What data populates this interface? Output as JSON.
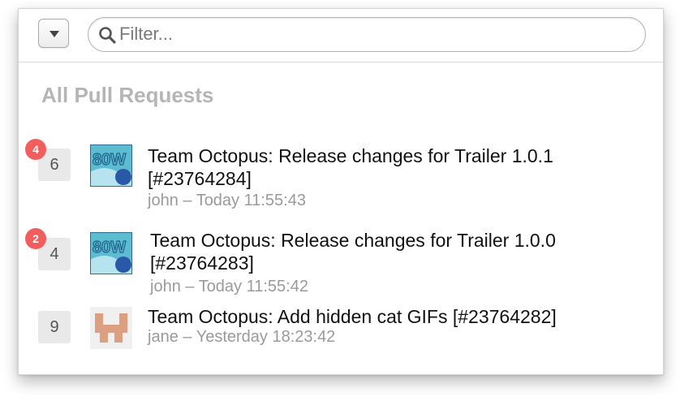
{
  "toolbar": {
    "menu_button_icon": "triangle-down-icon",
    "search_icon": "magnifier-icon",
    "search_placeholder": "Filter...",
    "search_value": ""
  },
  "section": {
    "title": "All Pull Requests"
  },
  "pull_requests": [
    {
      "title": "Team Octopus: Release changes for Trailer 1.0.1 [#23764284]",
      "author": "john",
      "time": "Today 11:55:43",
      "subtitle": "john – Today 11:55:43",
      "comment_count": "6",
      "new_count": "4",
      "avatar": "80w-avatar"
    },
    {
      "title": "Team Octopus: Release changes for Trailer 1.0.0 [#23764283]",
      "author": "john",
      "time": "Today 11:55:42",
      "subtitle": "john – Today 11:55:42",
      "comment_count": "4",
      "new_count": "2",
      "avatar": "80w-avatar"
    },
    {
      "title": "Team Octopus: Add hidden cat GIFs [#23764282]",
      "author": "jane",
      "time": "Yesterday 18:23:42",
      "subtitle": "jane – Yesterday 18:23:42",
      "comment_count": "9",
      "new_count": "",
      "avatar": "identicon-avatar"
    }
  ],
  "colors": {
    "badge": "#f25d5d",
    "section_title": "#b5b5b5",
    "subtitle": "#9a9a9a",
    "count_box": "#e9e9e9"
  }
}
